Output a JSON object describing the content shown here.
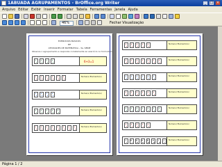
{
  "window": {
    "title": "1ABUADA AGRUPAMENTOS - BrOffice.org Writer"
  },
  "menu": [
    "Arquivo",
    "Editar",
    "Exibir",
    "Inserir",
    "Formatar",
    "Tabela",
    "Ferramentas",
    "Janela",
    "Ajuda"
  ],
  "toolbar": {
    "zoom_value": "46%",
    "close_preview_label": "Fechar Visualização"
  },
  "document": {
    "title_lines": [
      "EXERCÍCIOS BÁSICOS",
      "DE",
      "ATIVIDADES DE MATEMÁTICA - 3a. SÉRIE"
    ],
    "instruction": "Observe o agrupamento e responda corretamente ao exercício no formulário",
    "answer_label": "Nome(s) Elemento(s)",
    "example_expression": "6+3=1",
    "left_page_rows": [
      {
        "cards": 4,
        "color": "#2a8a4a"
      },
      {
        "cards": 6,
        "color": "#c03030"
      },
      {
        "cards": 4,
        "color": "#2a6acc"
      },
      {
        "cards": 5,
        "color": "#2a8a4a"
      },
      {
        "cards": 8,
        "color": "#c03030"
      }
    ],
    "right_page_rows": [
      {
        "cards": 5,
        "color": "#c03030"
      },
      {
        "cards": 7,
        "color": "#c03030"
      },
      {
        "cards": 6,
        "color": "#2a6acc"
      },
      {
        "cards": 6,
        "color": "#c03030"
      },
      {
        "cards": 7,
        "color": "#2a8a4a"
      },
      {
        "cards": 5,
        "color": "#c03030"
      },
      {
        "cards": 8,
        "color": "#555555"
      }
    ]
  },
  "status": {
    "text": "Página 1 / 2"
  }
}
